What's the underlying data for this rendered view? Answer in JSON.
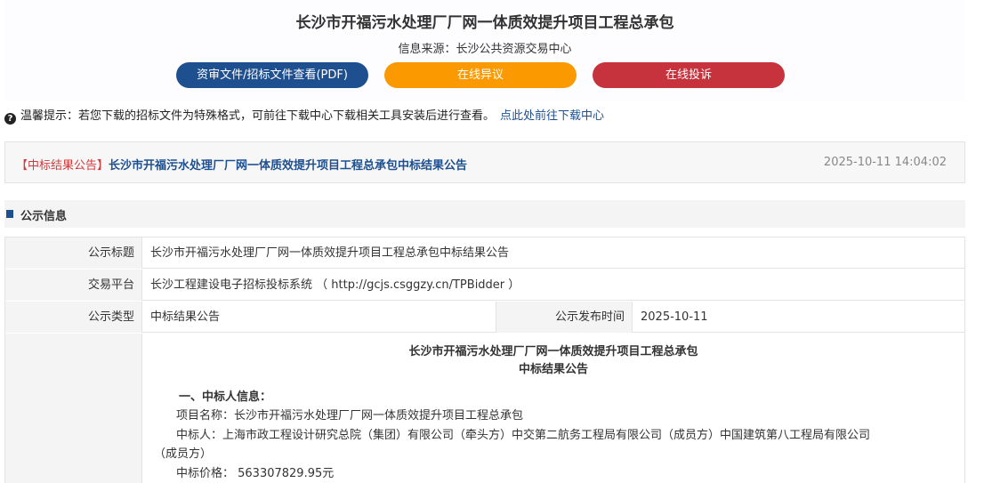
{
  "header": {
    "title": "长沙市开福污水处理厂厂网一体质效提升项目工程总承包",
    "source": "信息来源：长沙公共资源交易中心",
    "buttons": {
      "pdf": "资审文件/招标文件查看(PDF)",
      "objection": "在线异议",
      "complaint": "在线投诉"
    }
  },
  "tip": {
    "icon": "question-icon",
    "text": "温馨提示：若您下载的招标文件为特殊格式，可前往下载中心下载相关工具安装后进行查看。",
    "link": "点此处前往下载中心"
  },
  "notice": {
    "tag": "【中标结果公告】",
    "title": "长沙市开福污水处理厂厂网一体质效提升项目工程总承包中标结果公告",
    "date": "2025-10-11 14:04:02"
  },
  "section": {
    "title": "公示信息"
  },
  "info": {
    "title_label": "公示标题",
    "title_value": "长沙市开福污水处理厂厂网一体质效提升项目工程总承包中标结果公告",
    "platform_label": "交易平台",
    "platform_value": "长沙工程建设电子招标投标系统 （ http://gcjs.csggzy.cn/TPBidder ）",
    "type_label": "公示类型",
    "type_value": "中标结果公告",
    "publish_label": "公示发布时间",
    "publish_value": "2025-10-11"
  },
  "content": {
    "heading_line1": "长沙市开福污水处理厂厂网一体质效提升项目工程总承包",
    "heading_line2": "中标结果公告",
    "section1": "一、中标人信息：",
    "project_name": "项目名称：长沙市开福污水处理厂厂网一体质效提升项目工程总承包",
    "winner_line1": "中标人：上海市政工程设计研究总院（集团）有限公司（牵头方）中交第二航务工程局有限公司（成员方）中国建筑第八工程局有限公司",
    "winner_line2": "（成员方）",
    "price": "中标价格： 563307829.95元"
  },
  "colors": {
    "primary_blue": "#1e4f8f",
    "orange": "#fa9a00",
    "red": "#c6333d"
  }
}
